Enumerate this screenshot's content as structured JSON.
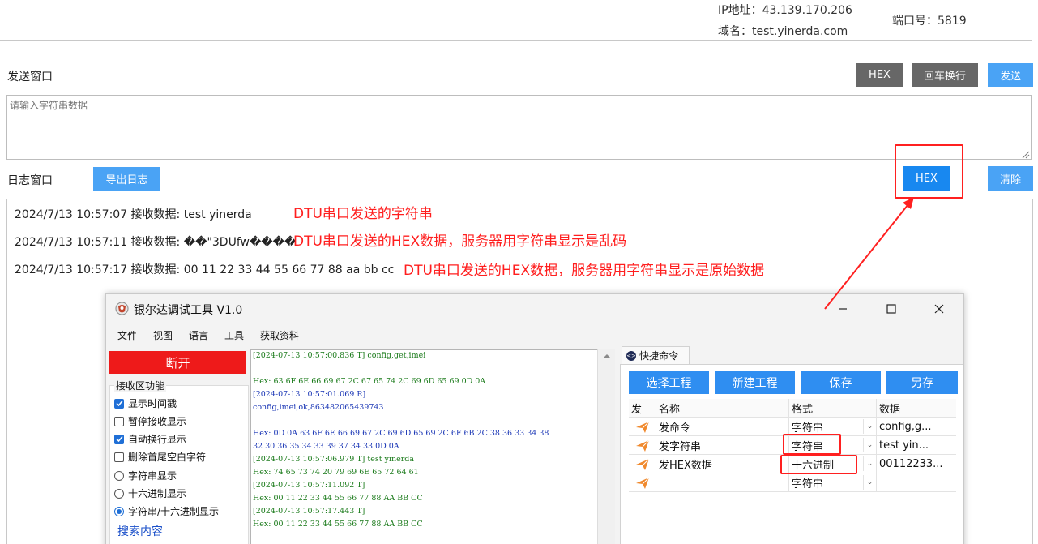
{
  "server": {
    "ip_label": "IP地址：",
    "ip_value": "43.139.170.206",
    "domain_label": "域名：",
    "domain_value": "test.yinerda.com",
    "port_label": "端口号：",
    "port_value": "5819"
  },
  "send_window": {
    "title": "发送窗口",
    "hex_label": "HEX",
    "crlf_label": "回车换行",
    "send_label": "发送",
    "placeholder": "请输入字符串数据"
  },
  "log_window": {
    "title": "日志窗口",
    "export_label": "导出日志",
    "hex_label": "HEX",
    "clear_label": "清除",
    "lines": [
      {
        "text": "2024/7/13 10:57:07 接收数据: test yinerda",
        "note": "DTU串口发送的字符串"
      },
      {
        "text": "2024/7/13 10:57:11 接收数据: ��\"3DUfw����",
        "note": "DTU串口发送的HEX数据，服务器用字符串显示是乱码"
      },
      {
        "text": "2024/7/13 10:57:17 接收数据: 00 11 22 33 44 55 66 77 88 aa bb cc",
        "note": "DTU串口发送的HEX数据，服务器用字符串显示是原始数据"
      }
    ]
  },
  "colors": {
    "annotation_red": "#ff1e1e",
    "gray_button": "#676767",
    "blue_button": "#4aa3f5",
    "hex_button_active": "#1888f0"
  },
  "app": {
    "title": "银尔达调试工具 V1.0",
    "minimize_icon": "minimize-icon",
    "maximize_icon": "maximize-icon",
    "close_icon": "close-icon",
    "menu": [
      "文件",
      "视图",
      "语言",
      "工具",
      "获取资料"
    ],
    "disconnect_label": "断开",
    "recv_group_title": "接收区功能",
    "options": [
      {
        "label": "显示时间戳",
        "type": "checkbox",
        "checked": true
      },
      {
        "label": "暂停接收显示",
        "type": "checkbox",
        "checked": false
      },
      {
        "label": "自动换行显示",
        "type": "checkbox",
        "checked": true
      },
      {
        "label": "删除首尾空白字符",
        "type": "checkbox",
        "checked": false
      },
      {
        "label": "字符串显示",
        "type": "radio",
        "checked": false
      },
      {
        "label": "十六进制显示",
        "type": "radio",
        "checked": false
      },
      {
        "label": "字符串/十六进制显示",
        "type": "radio",
        "checked": true
      }
    ],
    "search_label": "搜索内容",
    "recv_lines": [
      {
        "text": "[2024-07-13 10:57:00.836 T] config,get,imei",
        "color": "#1a7a1a"
      },
      {
        "text": "",
        "color": "#1a7a1a"
      },
      {
        "text": "Hex: 63 6F 6E 66 69 67 2C 67 65 74 2C 69 6D 65 69 0D 0A",
        "color": "#1a7a1a"
      },
      {
        "text": "[2024-07-13 10:57:01.069 R]",
        "color": "#1a36b5"
      },
      {
        "text": "config,imei,ok,863482065439743",
        "color": "#1a36b5"
      },
      {
        "text": "",
        "color": "#1a36b5"
      },
      {
        "text": "Hex: 0D 0A 63 6F 6E 66 69 67 2C 69 6D 65 69 2C 6F 6B 2C 38 36 33 34 38",
        "color": "#1a36b5"
      },
      {
        "text": "32 30 36 35 34 33 39 37 34 33 0D 0A",
        "color": "#1a36b5"
      },
      {
        "text": "[2024-07-13 10:57:06.979 T] test yinerda",
        "color": "#1a7a1a"
      },
      {
        "text": "Hex: 74 65 73 74 20 79 69 6E 65 72 64 61",
        "color": "#1a7a1a"
      },
      {
        "text": "[2024-07-13 10:57:11.092 T]",
        "color": "#1a7a1a"
      },
      {
        "text": "Hex: 00 11 22 33 44 55 66 77 88 AA BB CC",
        "color": "#1a7a1a"
      },
      {
        "text": "[2024-07-13 10:57:17.443 T]",
        "color": "#1a7a1a"
      },
      {
        "text": "Hex: 00 11 22 33 44 55 66 77 88 AA BB CC",
        "color": "#1a7a1a"
      }
    ],
    "quick_tab": "快捷命令",
    "project_buttons": [
      "选择工程",
      "新建工程",
      "保存",
      "另存"
    ],
    "table_headers": [
      "发",
      "名称",
      "格式",
      "数据"
    ],
    "table_rows": [
      {
        "name": "发命令",
        "format": "字符串",
        "data": "config,g..."
      },
      {
        "name": "发字符串",
        "format": "字符串",
        "data": "test yin..."
      },
      {
        "name": "发HEX数据",
        "format": "十六进制",
        "data": "00112233..."
      },
      {
        "name": "",
        "format": "字符串",
        "data": ""
      }
    ]
  }
}
